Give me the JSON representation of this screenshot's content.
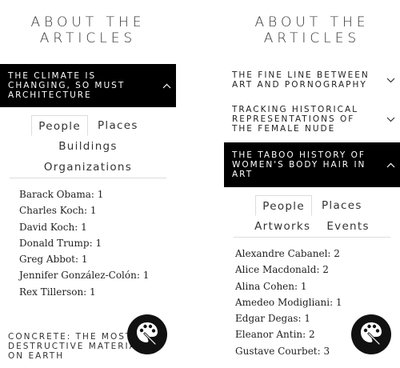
{
  "left": {
    "heading": [
      "ABOUT THE",
      "ARTICLES"
    ],
    "articles": [
      {
        "title": "THE CLIMATE IS CHANGING, SO MUST ARCHITECTURE",
        "active": true
      },
      {
        "title": "CONCRETE: THE MOST DESTRUCTIVE MATERIAL ON EARTH",
        "active": false
      }
    ],
    "tabs": [
      "People",
      "Places",
      "Buildings",
      "Organizations"
    ],
    "selected_tab": "People",
    "items": [
      "Barack Obama: 1",
      "Charles Koch: 1",
      "David Koch: 1",
      "Donald Trump: 1",
      "Greg Abbot: 1",
      "Jennifer González-Colón: 1",
      "Rex Tillerson: 1"
    ]
  },
  "right": {
    "heading": [
      "ABOUT THE",
      "ARTICLES"
    ],
    "articles": [
      {
        "title": "THE FINE LINE BETWEEN ART AND PORNOGRAPHY",
        "active": false
      },
      {
        "title": "TRACKING HISTORICAL REPRESENTATIONS OF THE FEMALE NUDE",
        "active": false
      },
      {
        "title": "THE TABOO HISTORY OF WOMEN'S BODY HAIR IN ART",
        "active": true
      }
    ],
    "tabs": [
      "People",
      "Places",
      "Artworks",
      "Events"
    ],
    "selected_tab": "People",
    "items": [
      "Alexandre Cabanel: 2",
      "Alice Macdonald: 2",
      "Alina Cohen: 1",
      "Amedeo Modigliani: 1",
      "Edgar Degas: 1",
      "Eleanor Antin: 2",
      "Gustave Courbet: 3"
    ]
  },
  "icons": {
    "chevron_up": "chevron-up-icon",
    "chevron_down": "chevron-down-icon",
    "palette": "palette-icon"
  },
  "colors": {
    "active_bg": "#000000",
    "fab_bg": "#111111"
  }
}
